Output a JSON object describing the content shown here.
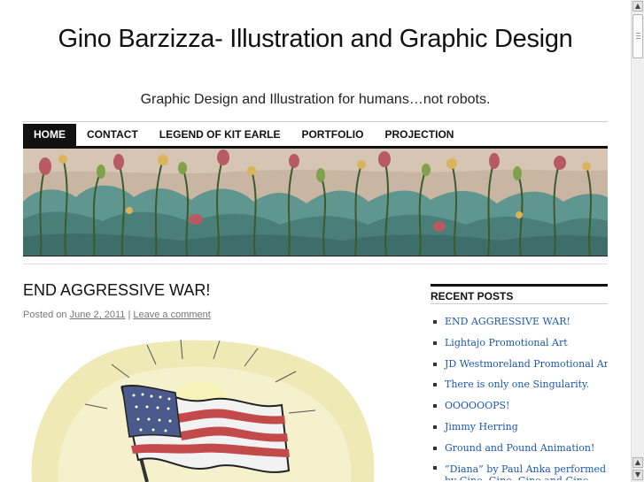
{
  "site": {
    "title": "Gino Barzizza- Illustration and Graphic Design",
    "description": "Graphic Design and Illustration for humans…not robots."
  },
  "nav": {
    "items": [
      {
        "label": "HOME",
        "active": true
      },
      {
        "label": "CONTACT",
        "active": false
      },
      {
        "label": "LEGEND OF KIT EARLE",
        "active": false
      },
      {
        "label": "PORTFOLIO",
        "active": false
      },
      {
        "label": "PROJECTION",
        "active": false
      }
    ]
  },
  "post": {
    "title": "END AGGRESSIVE WAR!",
    "posted_on": "Posted on",
    "date": "June 2, 2011",
    "separator": "|",
    "comment_link": "Leave a comment"
  },
  "sidebar": {
    "recent_posts_title": "RECENT POSTS",
    "recent_posts": [
      "END AGGRESSIVE WAR!",
      "Lightajo Promotional Art",
      "JD Westmoreland Promotional Art",
      "There is only one Singularity.",
      "OOOOOOPS!",
      "Jimmy Herring",
      "Ground and Pound Animation!",
      "“Diana” by Paul Anka performed by Gino, Gino, Gino and Gino"
    ]
  },
  "scrollbar": {
    "up_icon": "arrow-up-icon",
    "down_icon": "arrow-down-icon"
  },
  "colors": {
    "link": "#1b57b1",
    "nav_active_bg": "#111111",
    "banner_sky": "#cdb9a4",
    "banner_foliage": "#4f8a82"
  }
}
